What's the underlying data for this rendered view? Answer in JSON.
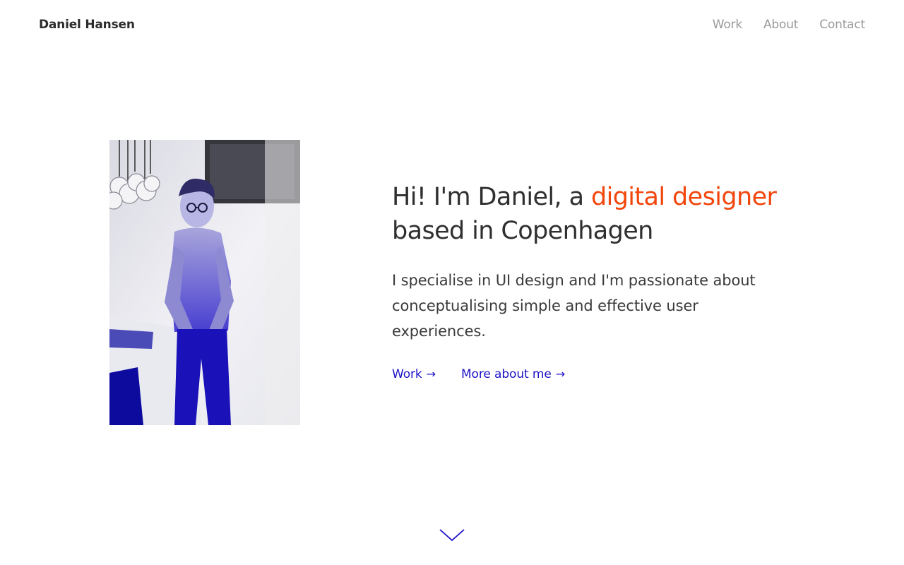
{
  "header": {
    "brand": "Daniel Hansen",
    "nav": [
      {
        "label": "Work"
      },
      {
        "label": "About"
      },
      {
        "label": "Contact"
      }
    ]
  },
  "hero": {
    "headline_before": "Hi! I'm Daniel, a ",
    "headline_accent": "digital designer",
    "headline_after": " based in Copenhagen",
    "lead": "I specialise in UI design and I'm passionate about conceptualising simple and effective user experiences.",
    "links": [
      {
        "label": "Work",
        "arrow": "→"
      },
      {
        "label": "More about me",
        "arrow": "→"
      }
    ],
    "photo_alt": "Daniel Hansen portrait"
  },
  "colors": {
    "accent": "#f2460c",
    "link": "#1c12c6",
    "nav": "#9a9a9a",
    "text": "#2f2f2f"
  },
  "icons": {
    "scroll_hint": "chevron-down-icon"
  }
}
